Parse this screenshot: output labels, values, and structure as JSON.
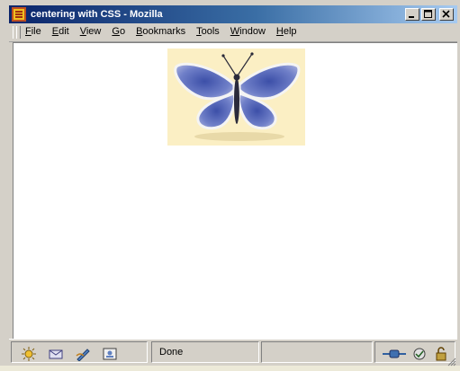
{
  "window": {
    "title": "centering with CSS - Mozilla"
  },
  "menu": {
    "items": [
      {
        "label": "File",
        "key": "F",
        "rest": "ile"
      },
      {
        "label": "Edit",
        "key": "E",
        "rest": "dit"
      },
      {
        "label": "View",
        "key": "V",
        "rest": "iew"
      },
      {
        "label": "Go",
        "key": "G",
        "rest": "o"
      },
      {
        "label": "Bookmarks",
        "key": "B",
        "rest": "ookmarks"
      },
      {
        "label": "Tools",
        "key": "T",
        "rest": "ools"
      },
      {
        "label": "Window",
        "key": "W",
        "rest": "indow"
      },
      {
        "label": "Help",
        "key": "H",
        "rest": "elp"
      }
    ]
  },
  "content": {
    "image_alt": "butterfly"
  },
  "status": {
    "text": "Done"
  },
  "icons": {
    "app": "mozilla-icon",
    "minimize": "minimize-icon",
    "maximize": "maximize-icon",
    "close": "close-icon",
    "navigator": "navigator-icon",
    "mail": "mail-icon",
    "composer": "composer-icon",
    "address_book": "address-book-icon",
    "online": "online-plug-icon",
    "security": "security-icon",
    "lock": "lock-icon"
  },
  "colors": {
    "title_start": "#0a246a",
    "title_end": "#a6caf0",
    "image_bg": "#fbefc4"
  }
}
